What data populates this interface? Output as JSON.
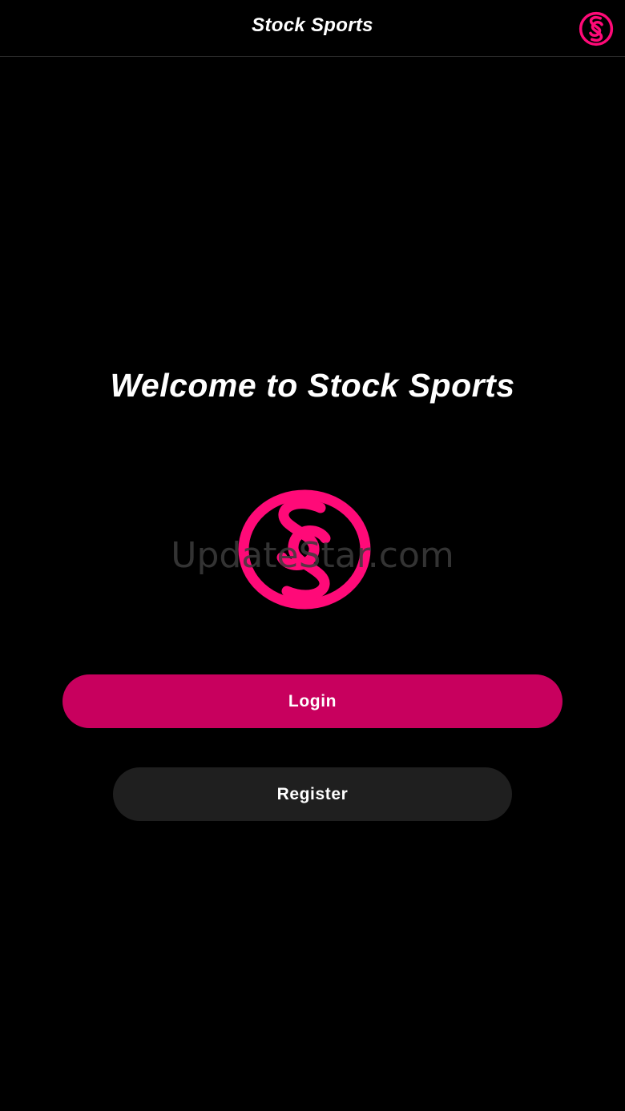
{
  "header": {
    "title": "Stock Sports",
    "logo_icon": "stock-sports-logo-icon"
  },
  "main": {
    "welcome_text": "Welcome to Stock Sports",
    "hero_logo_icon": "stock-sports-logo-icon",
    "watermark_text": "UpdateStar.com"
  },
  "actions": {
    "login_label": "Login",
    "register_label": "Register"
  },
  "colors": {
    "background": "#000000",
    "brand_pink": "#ff0a78",
    "login_button": "#c8005e",
    "register_button": "#1f1f1f",
    "text": "#ffffff"
  }
}
